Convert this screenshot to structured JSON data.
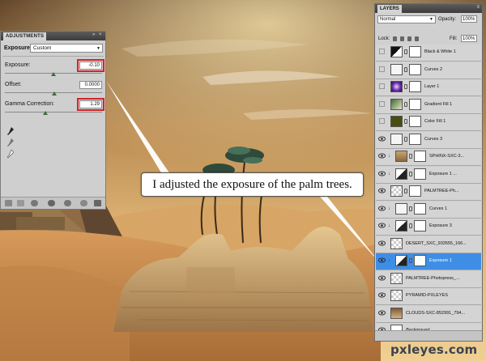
{
  "adjustments": {
    "panel_title": "ADJUSTMENTS",
    "type_label": "Exposure",
    "preset": "Custom",
    "fields": [
      {
        "label": "Exposure:",
        "value": "-0.10",
        "highlighted": true
      },
      {
        "label": "Offset:",
        "value": "0.0000",
        "highlighted": false
      },
      {
        "label": "Gamma Correction:",
        "value": "1.29",
        "highlighted": true
      }
    ],
    "tools": [
      "eyedropper-black-icon",
      "eyedropper-gray-icon",
      "eyedropper-white-icon"
    ],
    "bottom_icons": [
      "back-arrow-icon",
      "panel-view-icon",
      "clip-icon",
      "visibility-icon",
      "previous-state-icon",
      "reset-icon",
      "delete-icon"
    ]
  },
  "callout": {
    "text": "I adjusted the exposure of the palm trees."
  },
  "layers": {
    "panel_title": "LAYERS",
    "blend_mode": "Normal",
    "opacity_label": "Opacity:",
    "opacity": "100%",
    "lock_label": "Lock:",
    "fill_label": "Fill:",
    "fill": "100%",
    "items": [
      {
        "name": "Black & White 1",
        "visible": false,
        "clipped": false,
        "selected": false,
        "italic": false,
        "thumb": "adjust-bw",
        "has_mask": true
      },
      {
        "name": "Curves 2",
        "visible": false,
        "clipped": false,
        "selected": false,
        "italic": false,
        "thumb": "adjust-curves",
        "has_mask": true
      },
      {
        "name": "Layer 1",
        "visible": false,
        "clipped": false,
        "selected": false,
        "italic": false,
        "thumb": "purple-glow",
        "has_mask": true
      },
      {
        "name": "Gradient Fill 1",
        "visible": false,
        "clipped": false,
        "selected": false,
        "italic": false,
        "thumb": "gradient",
        "has_mask": true
      },
      {
        "name": "Color Fill 1",
        "visible": false,
        "clipped": false,
        "selected": false,
        "italic": false,
        "thumb": "olive",
        "has_mask": true
      },
      {
        "name": "Curves 3",
        "visible": true,
        "clipped": false,
        "selected": false,
        "italic": false,
        "thumb": "adjust-curves",
        "has_mask": true
      },
      {
        "name": "SPHINX-SXC-3...",
        "visible": true,
        "clipped": true,
        "selected": false,
        "italic": false,
        "thumb": "sphinx",
        "has_mask": true
      },
      {
        "name": "Exposure 1 ...",
        "visible": true,
        "clipped": true,
        "selected": false,
        "italic": false,
        "thumb": "adjust-exposure",
        "has_mask": true
      },
      {
        "name": "PALMTREE-Ph...",
        "visible": true,
        "clipped": false,
        "selected": false,
        "italic": false,
        "thumb": "transparent",
        "has_mask": true
      },
      {
        "name": "Curves 1",
        "visible": true,
        "clipped": true,
        "selected": false,
        "italic": false,
        "thumb": "adjust-curves",
        "has_mask": true
      },
      {
        "name": "Exposure 3",
        "visible": true,
        "clipped": true,
        "selected": false,
        "italic": false,
        "thumb": "adjust-exposure",
        "has_mask": true
      },
      {
        "name": "DESERT_SXC_933555_166...",
        "visible": true,
        "clipped": false,
        "selected": false,
        "italic": false,
        "thumb": "transparent",
        "has_mask": false
      },
      {
        "name": "Exposure 1",
        "visible": true,
        "clipped": true,
        "selected": true,
        "italic": false,
        "thumb": "adjust-exposure",
        "has_mask": true
      },
      {
        "name": "PALMTREE-Photopress_...",
        "visible": true,
        "clipped": false,
        "selected": false,
        "italic": false,
        "thumb": "transparent",
        "has_mask": false
      },
      {
        "name": "PYRAMID-PXLEYES",
        "visible": true,
        "clipped": false,
        "selected": false,
        "italic": false,
        "thumb": "transparent",
        "has_mask": false
      },
      {
        "name": "CLOUDS-SXC-852991_794...",
        "visible": true,
        "clipped": false,
        "selected": false,
        "italic": false,
        "thumb": "clouds",
        "has_mask": false
      },
      {
        "name": "Background",
        "visible": true,
        "clipped": false,
        "selected": false,
        "italic": true,
        "thumb": "white",
        "has_mask": false
      }
    ]
  },
  "watermark": "pxleyes.com",
  "colors": {
    "highlight": "#d2252a",
    "selection": "#3f8ee6",
    "panel": "#d0d0d0"
  }
}
